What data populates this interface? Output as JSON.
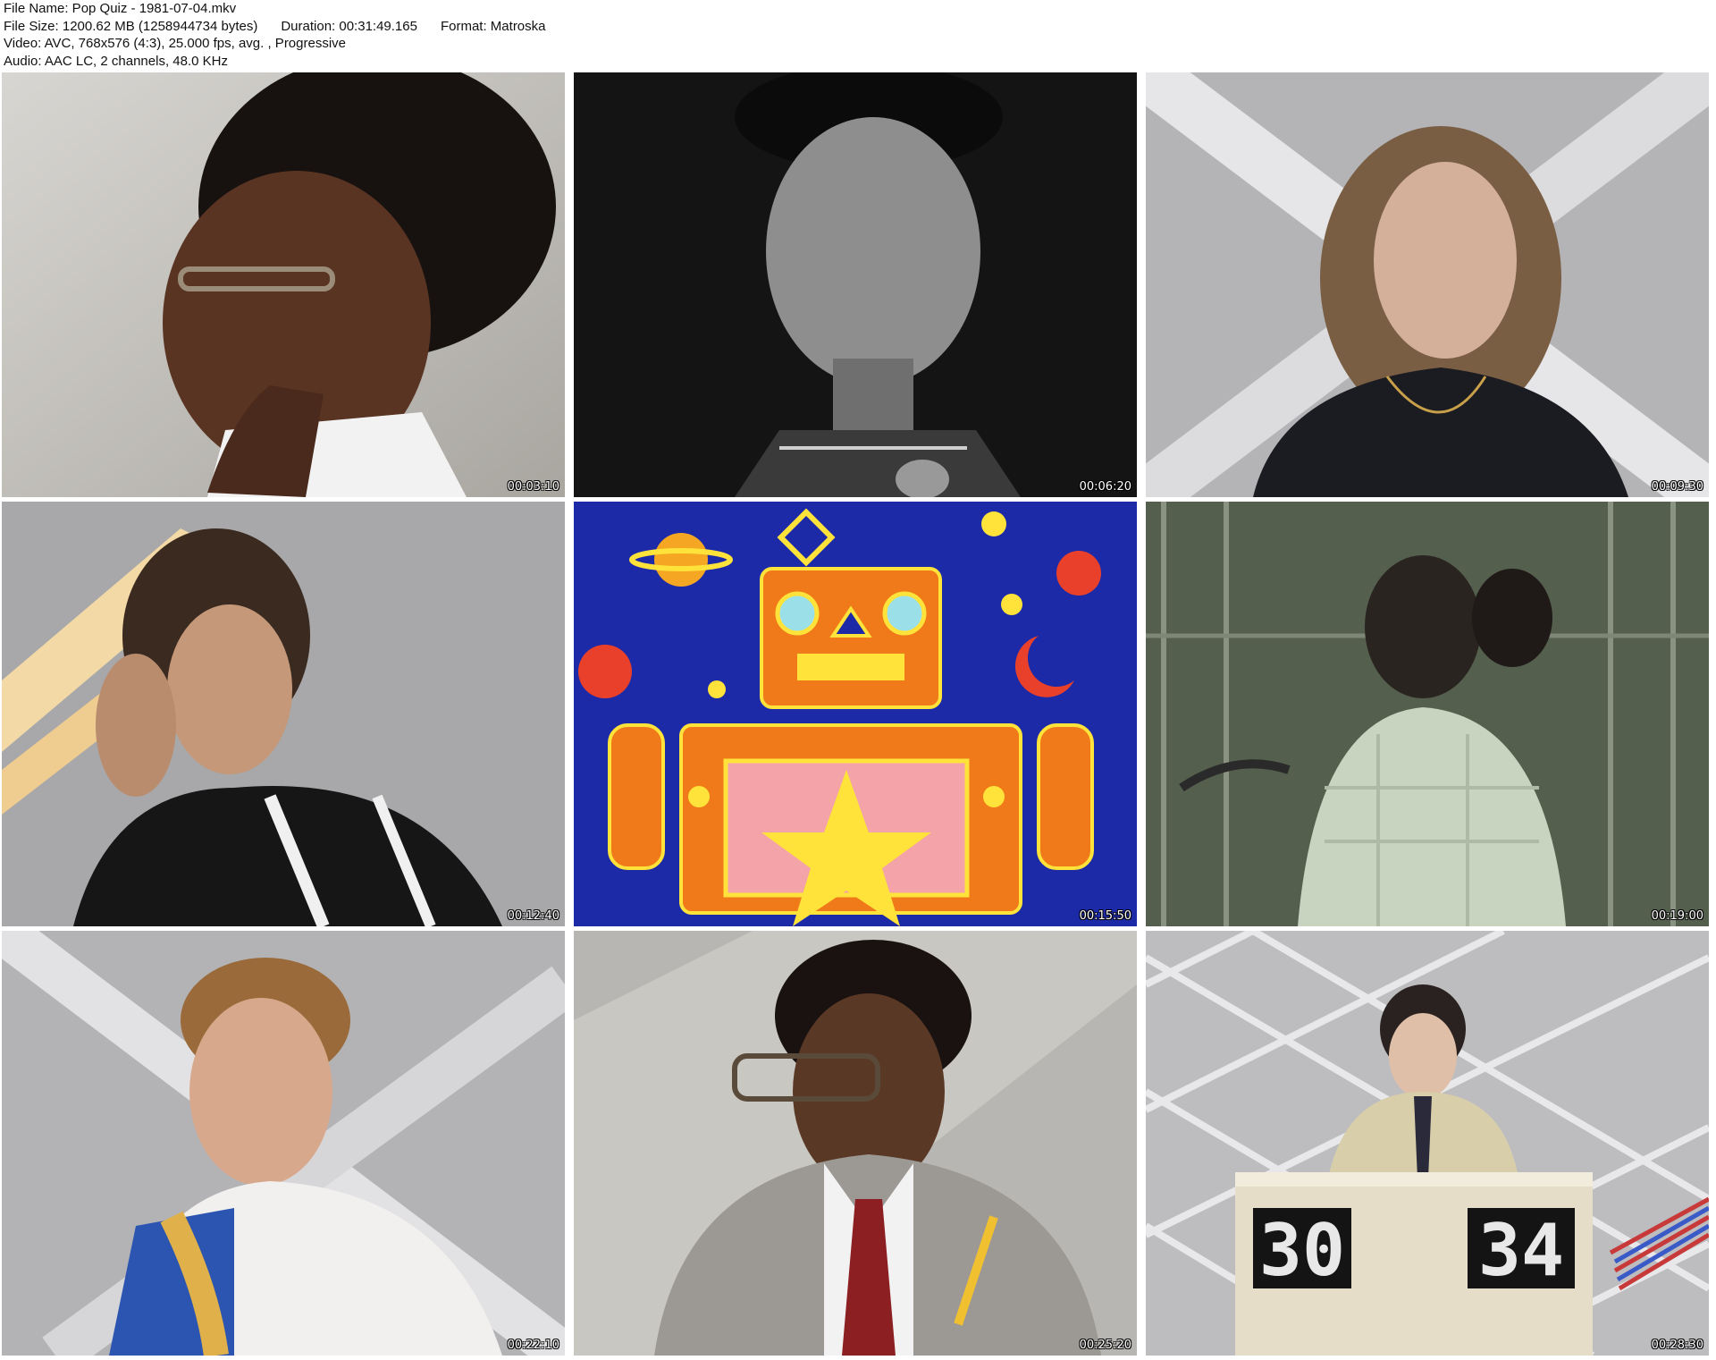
{
  "info": {
    "file_name": "File Name: Pop Quiz - 1981-07-04.mkv",
    "file_size": "File Size: 1200.62 MB (1258944734 bytes)",
    "duration": "Duration: 00:31:49.165",
    "format": "Format: Matroska",
    "video": "Video: AVC, 768x576 (4:3), 25.000 fps, avg. , Progressive",
    "audio": "Audio: AAC LC, 2 channels, 48.0 KHz"
  },
  "frames": [
    {
      "timestamp": "00:03:10"
    },
    {
      "timestamp": "00:06:20"
    },
    {
      "timestamp": "00:09:30"
    },
    {
      "timestamp": "00:12:40"
    },
    {
      "timestamp": "00:15:50"
    },
    {
      "timestamp": "00:19:00"
    },
    {
      "timestamp": "00:22:10"
    },
    {
      "timestamp": "00:25:20"
    },
    {
      "timestamp": "00:28:30"
    }
  ],
  "scoreboard": {
    "left": "30",
    "right": "34"
  }
}
